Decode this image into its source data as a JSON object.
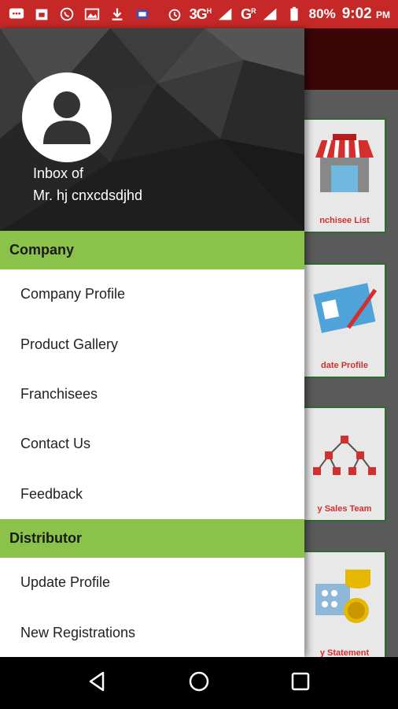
{
  "status_bar": {
    "battery": "80%",
    "time": "9:02",
    "ampm": "PM",
    "network_1": "3G",
    "network_1_sup": "H",
    "network_2": "G",
    "network_2_sup": "R"
  },
  "background_tiles": [
    {
      "label": "nchisee List",
      "icon": "shop-icon"
    },
    {
      "label": "date Profile",
      "icon": "id-card-icon"
    },
    {
      "label": "y Sales Team",
      "icon": "hierarchy-icon"
    },
    {
      "label": "y Statement",
      "icon": "coins-icon"
    }
  ],
  "drawer": {
    "header": {
      "line1": "Inbox of",
      "line2": "Mr. hj cnxcdsdjhd"
    },
    "sections": [
      {
        "title": "Company",
        "items": [
          "Company Profile",
          "Product Gallery",
          "Franchisees",
          "Contact Us",
          "Feedback"
        ]
      },
      {
        "title": "Distributor",
        "items": [
          "Update Profile",
          "New Registrations"
        ]
      }
    ]
  },
  "colors": {
    "status_bar": "#c62828",
    "section_header": "#8bc34a",
    "tile_label": "#d32f2f"
  }
}
